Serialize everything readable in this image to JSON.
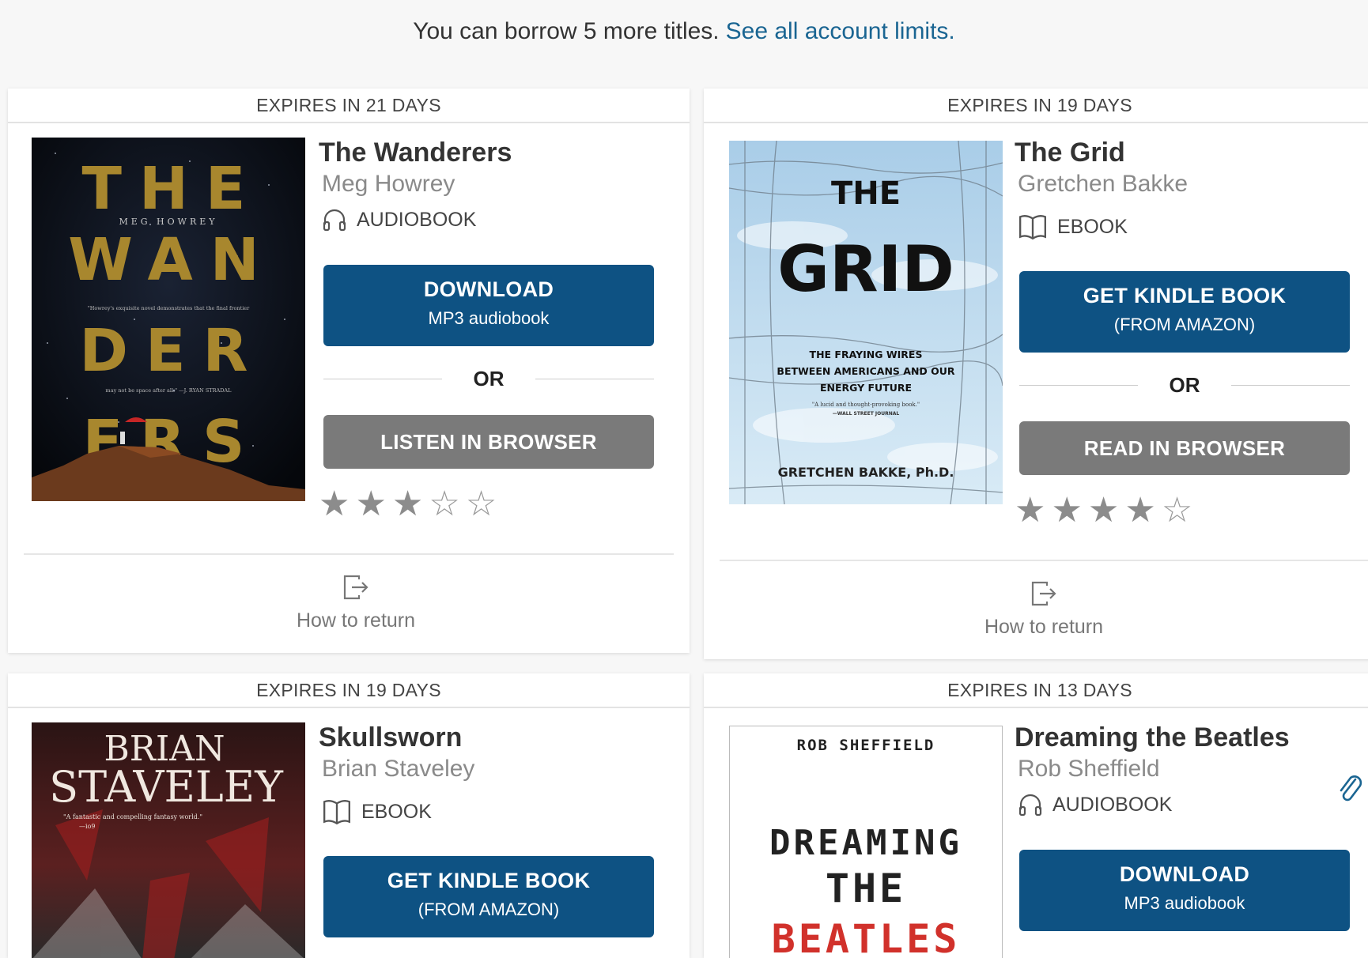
{
  "header": {
    "borrow_text": "You can borrow 5 more titles.",
    "limits_link": "See all account limits."
  },
  "colors": {
    "primary": "#0e5283",
    "secondary": "#7a7a7a",
    "link": "#1a6592"
  },
  "cards": [
    {
      "expires": "EXPIRES IN 21 DAYS",
      "title": "The Wanderers",
      "author": "Meg Howrey",
      "format_icon": "headphones-icon",
      "format": "AUDIOBOOK",
      "primary_l1": "DOWNLOAD",
      "primary_l2": "MP3 audiobook",
      "or": "OR",
      "secondary": "LISTEN IN BROWSER",
      "rating": 3,
      "rating_max": 5,
      "return_label": "How to return",
      "cover": {
        "line1": "THE",
        "line2": "WAN",
        "line3": "DER",
        "line4": "ERS",
        "author": "MEG HOWREY",
        "quote": "\"Howrey's exquisite novel demonstrates that the final frontier",
        "quote2": "may not be space after all.\" —J. RYAN STRADAL"
      }
    },
    {
      "expires": "EXPIRES IN 19 DAYS",
      "title": "The Grid",
      "author": "Gretchen Bakke",
      "format_icon": "book-open-icon",
      "format": "EBOOK",
      "primary_l1": "GET KINDLE BOOK",
      "primary_l2": "(FROM AMAZON)",
      "or": "OR",
      "secondary": "READ IN BROWSER",
      "rating": 4,
      "rating_max": 5,
      "return_label": "How to return",
      "cover": {
        "the": "THE",
        "grid": "GRID",
        "sub1": "THE FRAYING WIRES",
        "sub2": "BETWEEN AMERICANS AND OUR",
        "sub3": "ENERGY FUTURE",
        "quote": "\"A lucid and thought-provoking book.\"",
        "quote2": "—WALL STREET JOURNAL",
        "author": "GRETCHEN BAKKE, Ph.D."
      }
    },
    {
      "expires": "EXPIRES IN 19 DAYS",
      "title": "Skullsworn",
      "author": "Brian Staveley",
      "format_icon": "book-open-icon",
      "format": "EBOOK",
      "primary_l1": "GET KINDLE BOOK",
      "primary_l2": "(FROM AMAZON)",
      "cover": {
        "line1": "BRIAN",
        "line2": "STAVELEY",
        "quote": "\"A fantastic and compelling fantasy world.\"",
        "quote2": "—io9"
      }
    },
    {
      "expires": "EXPIRES IN 13 DAYS",
      "title": "Dreaming the Beatles",
      "author": "Rob Sheffield",
      "format_icon": "headphones-icon",
      "format": "AUDIOBOOK",
      "primary_l1": "DOWNLOAD",
      "primary_l2": "MP3 audiobook",
      "cover": {
        "author": "ROB SHEFFIELD",
        "line1": "DREAMING",
        "line2": "THE",
        "line3": "BEATLES"
      }
    }
  ]
}
